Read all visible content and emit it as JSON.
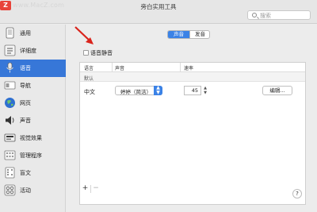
{
  "watermark": {
    "logo": "Z",
    "text": "www.MacZ.com"
  },
  "window": {
    "title": "旁白实用工具"
  },
  "search": {
    "placeholder": "搜索"
  },
  "sidebar": {
    "items": [
      {
        "label": "通用",
        "icon": "general-icon",
        "selected": false
      },
      {
        "label": "详细度",
        "icon": "verbosity-icon",
        "selected": false
      },
      {
        "label": "语音",
        "icon": "speech-icon",
        "selected": true
      },
      {
        "label": "导航",
        "icon": "navigation-icon",
        "selected": false
      },
      {
        "label": "网页",
        "icon": "web-icon",
        "selected": false
      },
      {
        "label": "声音",
        "icon": "sound-icon",
        "selected": false
      },
      {
        "label": "视觉效果",
        "icon": "visuals-icon",
        "selected": false
      },
      {
        "label": "管理程序",
        "icon": "commanders-icon",
        "selected": false
      },
      {
        "label": "盲文",
        "icon": "braille-icon",
        "selected": false
      },
      {
        "label": "活动",
        "icon": "activities-icon",
        "selected": false
      }
    ]
  },
  "tabs": [
    {
      "label": "声音",
      "selected": true
    },
    {
      "label": "发音",
      "selected": false
    }
  ],
  "mute_speech": {
    "label": "语音静音",
    "checked": false
  },
  "table": {
    "columns": [
      "语言",
      "声音",
      "速率"
    ],
    "group": "默认",
    "rows": [
      {
        "language": "中文",
        "voice": "婷婷（简洁）",
        "rate": "45",
        "edit": "编辑..."
      }
    ]
  },
  "controls": {
    "add": "+",
    "remove": "−",
    "help": "?"
  },
  "colors": {
    "accent": "#3777d8",
    "close": "#fc5f57",
    "minimize": "#fdbc2e",
    "zoom": "#28c840"
  }
}
